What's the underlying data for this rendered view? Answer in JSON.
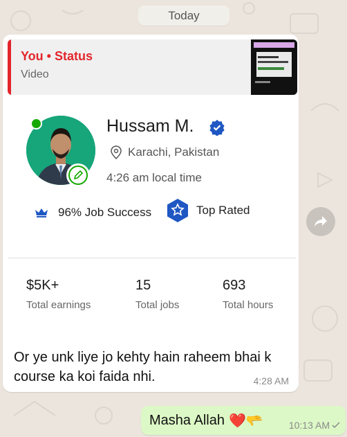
{
  "date_chip": "Today",
  "quoted_status": {
    "title": "You • Status",
    "subtitle": "Video"
  },
  "profile": {
    "name": "Hussam M.",
    "location": "Karachi, Pakistan",
    "local_time": "4:26 am local time",
    "job_success": "96% Job Success",
    "badge": "Top Rated",
    "stats": [
      {
        "value": "$5K+",
        "label": "Total earnings"
      },
      {
        "value": "15",
        "label": "Total jobs"
      },
      {
        "value": "693",
        "label": "Total hours"
      }
    ]
  },
  "incoming_message": {
    "text": "Or ye unk liye jo kehty hain raheem bhai k course ka koi faida nhi.",
    "time": "4:28 AM"
  },
  "outgoing_message": {
    "text": "Masha Allah",
    "emojis": "❤️🫳",
    "time": "10:13 AM"
  },
  "colors": {
    "status_red": "#e2262b",
    "upwork_green": "#14a800",
    "verified_blue": "#1f57c3",
    "outgoing_bubble": "#dcf8c6"
  }
}
